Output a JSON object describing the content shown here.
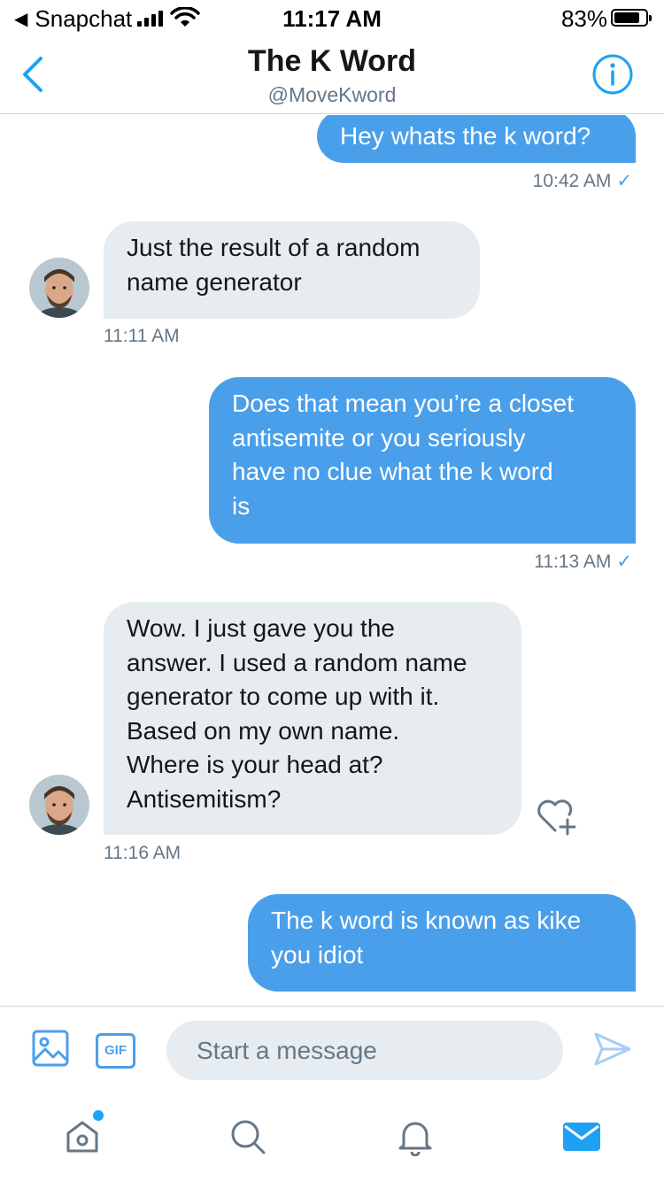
{
  "status_bar": {
    "back_app": "Snapchat",
    "time": "11:17 AM",
    "battery": "83%",
    "battery_level": 0.83
  },
  "header": {
    "title": "The K Word",
    "handle": "@MoveKword",
    "icons": [
      "back-chevron-icon",
      "info-icon"
    ]
  },
  "messages": [
    {
      "direction": "sent",
      "lines": [
        "Hey whats the k word?"
      ],
      "time": "10:42 AM",
      "read_check": "✓"
    },
    {
      "direction": "received",
      "lines": [
        "Just the result of a random",
        "name generator"
      ],
      "time": "11:11 AM"
    },
    {
      "direction": "sent",
      "lines": [
        "Does that mean you’re a closet",
        "antisemite or you seriously",
        "have no clue what the k word",
        "is"
      ],
      "time": "11:13 AM",
      "read_check": "✓"
    },
    {
      "direction": "received",
      "lines": [
        "Wow. I just gave you the",
        "answer. I used a random name",
        "generator to come up with it.",
        "Based on my own name.",
        "Where is your head at?",
        "Antisemitism?"
      ],
      "time": "11:16 AM"
    },
    {
      "direction": "sent",
      "lines": [
        "The k word is known as kike",
        "you idiot"
      ]
    }
  ],
  "composer": {
    "placeholder": "Start a message",
    "gif_label": "GIF"
  },
  "tab_bar": {
    "tabs": [
      "home-icon",
      "search-icon",
      "notifications-icon",
      "messages-icon"
    ],
    "active": "messages-icon",
    "accent": "#1da1f2"
  },
  "colors": {
    "accent": "#1da1f2",
    "sent_bubble": "#4a9fea",
    "received_bubble": "#e6ecf0",
    "meta_text": "#657786"
  }
}
